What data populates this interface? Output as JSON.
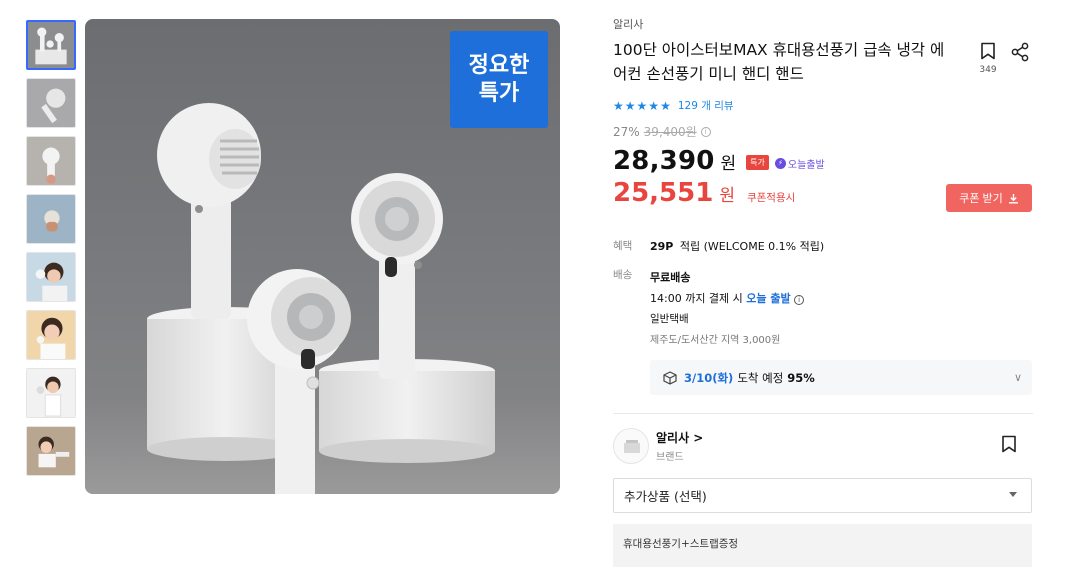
{
  "promo_badge": {
    "line1": "정요한",
    "line2": "특가"
  },
  "product": {
    "brand": "알리사",
    "title": "100단 아이스터보MAX 휴대용선풍기 급속 냉각 에어컨 손선풍기 미니 핸디 핸드",
    "wish_count": "349",
    "rating_stars": 5,
    "reviews": "129 개 리뷰",
    "discount_rate": "27%",
    "original_price": "39,400원",
    "price": "28,390",
    "price_unit": "원",
    "special_tag": "특가",
    "today_ship": "오늘출발",
    "coupon_price": "25,551",
    "coupon_unit": "원",
    "coupon_label": "쿠폰적용시",
    "coupon_button": "쿠폰 받기"
  },
  "benefit": {
    "label": "혜택",
    "points": "29P",
    "text": "적립 (WELCOME 0.1% 적립)"
  },
  "delivery": {
    "label": "배송",
    "free": "무료배송",
    "deadline_prefix": "14:00 까지 결제 시",
    "deadline_highlight": "오늘 출발",
    "method": "일반택배",
    "extra": "제주도/도서산간 지역 3,000원"
  },
  "arrival": {
    "date": "3/10(화)",
    "text": "도착 예정",
    "percent": "95%"
  },
  "seller": {
    "name": "알리사 >",
    "sub": "브랜드"
  },
  "add_option": {
    "placeholder": "추가상품 (선택)"
  },
  "option_item": "휴대용선풍기+스트랩증정",
  "colors": {
    "accent_blue": "#1e6fd9",
    "sale_red": "#e9453f",
    "coupon_btn": "#f06560"
  }
}
